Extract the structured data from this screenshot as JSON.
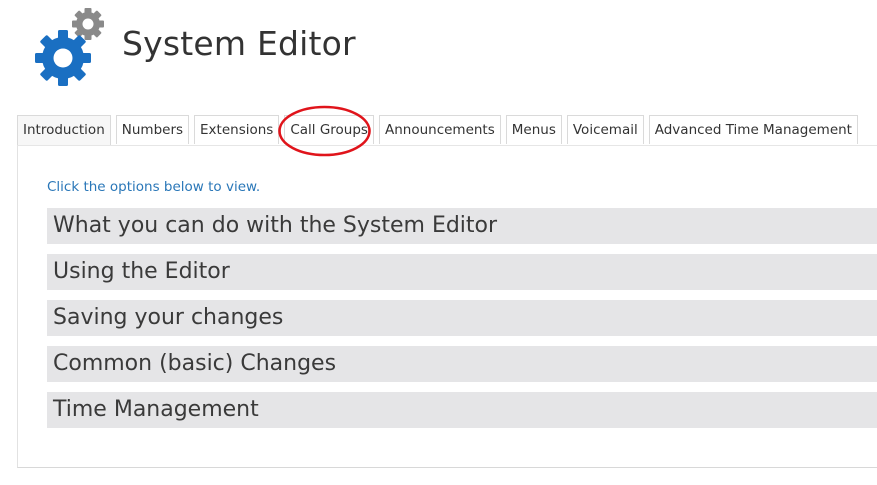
{
  "header": {
    "title": "System Editor"
  },
  "tabs": [
    {
      "label": "Introduction"
    },
    {
      "label": "Numbers"
    },
    {
      "label": "Extensions"
    },
    {
      "label": "Call Groups"
    },
    {
      "label": "Announcements"
    },
    {
      "label": "Menus"
    },
    {
      "label": "Voicemail"
    },
    {
      "label": "Advanced Time Management"
    }
  ],
  "active_tab": "Introduction",
  "highlighted_tab": "Call Groups",
  "main": {
    "intro_text": "Click the options below to view.",
    "sections": [
      {
        "label": "What you can do with the System Editor"
      },
      {
        "label": "Using the Editor"
      },
      {
        "label": "Saving your changes"
      },
      {
        "label": "Common (basic) Changes"
      },
      {
        "label": "Time Management"
      }
    ]
  },
  "colors": {
    "logo_blue": "#1a6fc2",
    "logo_gray": "#8a8a8a",
    "link_blue": "#2a77b8",
    "accordion_bg": "#e5e5e7",
    "highlight_red": "#e0141b"
  },
  "icons": {
    "logo": "gears-icon"
  }
}
